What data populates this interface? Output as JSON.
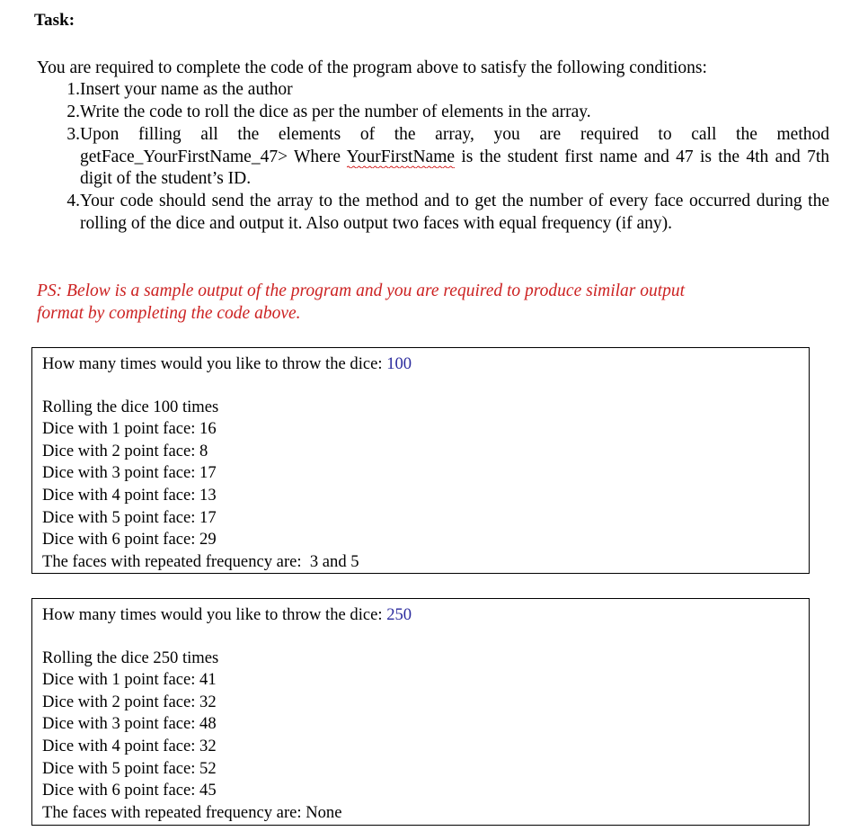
{
  "document": {
    "heading": "Task:",
    "intro": "You are required to complete the code of the program above to satisfy the following conditions:",
    "list": [
      {
        "num": "1.",
        "text": "Insert your name as the author"
      },
      {
        "num": "2.",
        "text": "Write the code to roll the dice as per the number of elements in the array."
      },
      {
        "num": "3.",
        "text_before": "Upon filling all the elements of the array, you are required to call the method getFace_YourFirstName_47> Where ",
        "misspelled_word": "YourFirstName",
        "text_after": " is the student first name and 47 is the 4th and 7th digit of the student’s ID."
      },
      {
        "num": "4.",
        "text": "Your code should send the array to the method and to get the number of every face occurred during the rolling of the dice and output it. Also output two faces with equal frequency (if any)."
      }
    ],
    "ps_note": {
      "line1": "PS: Below is a sample output of the program and you are required to produce similar output",
      "line2": "format by completing the code above.",
      "color": "#cc2222"
    }
  },
  "output_boxes": [
    {
      "prompt_label": "How many times would you like to throw the dice: ",
      "prompt_value": "100",
      "prompt_value_color": "#2b2b9e",
      "rolling_line": "Rolling the dice 100 times",
      "face_lines": [
        "Dice with 1 point face: 16",
        "Dice with 2 point face: 8",
        "Dice with 3 point face: 17",
        "Dice with 4 point face: 13",
        "Dice with 5 point face: 17",
        "Dice with 6 point face: 29"
      ],
      "repeated_line": "The faces with repeated frequency are:  3 and 5"
    },
    {
      "prompt_label": "How many times would you like to throw the dice: ",
      "prompt_value": "250",
      "prompt_value_color": "#2b2b9e",
      "rolling_line": "Rolling the dice 250 times",
      "face_lines": [
        "Dice with 1 point face: 41",
        "Dice with 2 point face: 32",
        "Dice with 3 point face: 48",
        "Dice with 4 point face: 32",
        "Dice with 5 point face: 52",
        "Dice with 6 point face: 45"
      ],
      "repeated_line": "The faces with repeated frequency are: None"
    }
  ]
}
